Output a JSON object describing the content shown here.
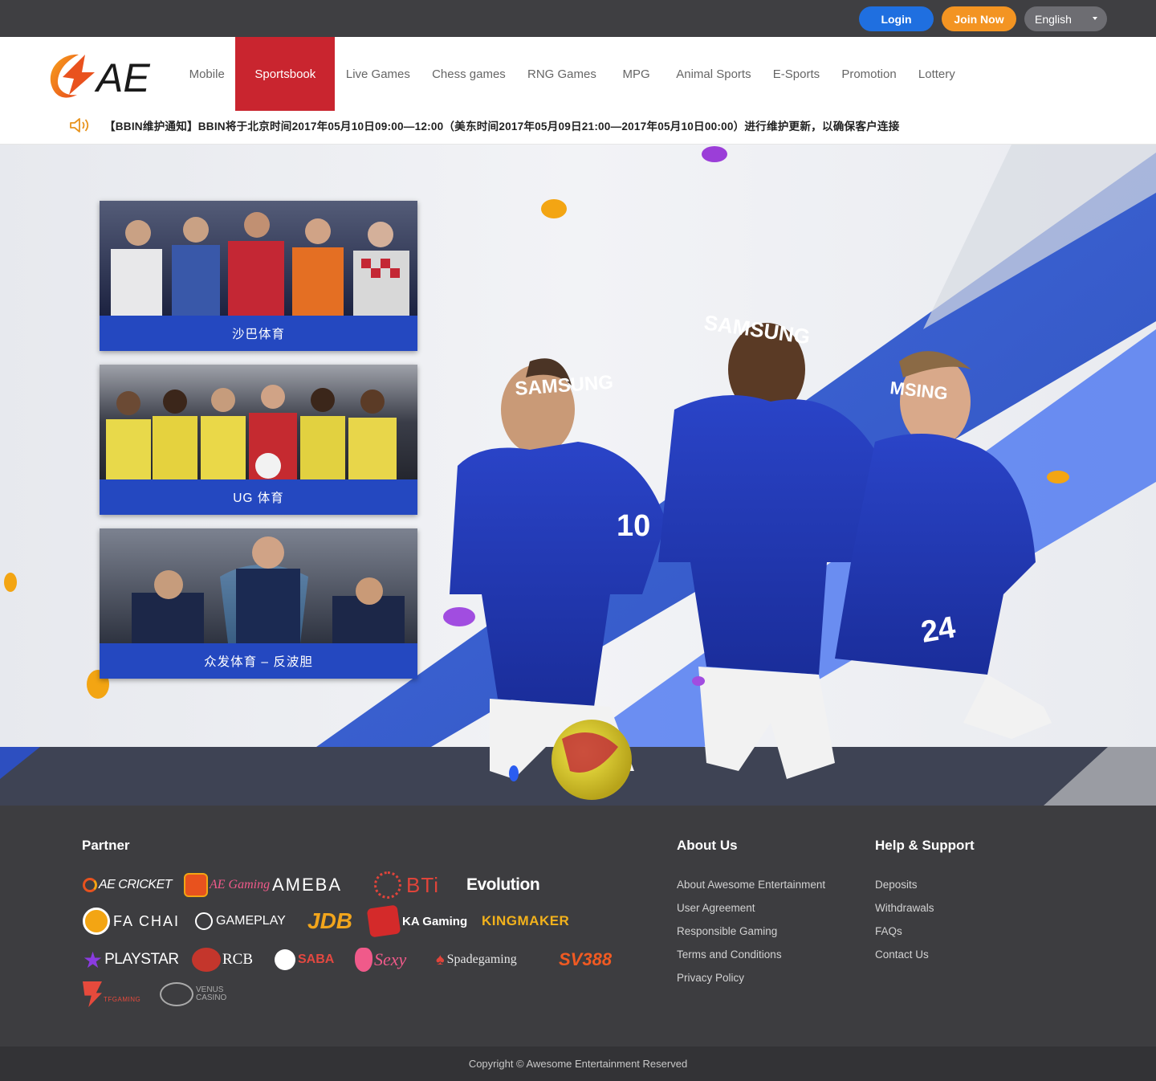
{
  "topbar": {
    "login_label": "Login",
    "join_label": "Join Now",
    "language": "English"
  },
  "header": {
    "logo_text": "AE",
    "nav": [
      "Mobile",
      "Sportsbook",
      "Live Games",
      "Chess games",
      "RNG Games",
      "MPG",
      "Animal Sports",
      "E-Sports",
      "Promotion",
      "Lottery"
    ],
    "active_nav": "Sportsbook",
    "ticker": "【BBIN维护通知】BBIN将于北京时间2017年05月10日09:00—12:00（美东时间2017年05月09日21:00—2017年05月10日00:00）进行维护更新，以确保客户连接"
  },
  "hero": {
    "cards": [
      {
        "label": "沙巴体育"
      },
      {
        "label": "UG 体育"
      },
      {
        "label": "众发体育 – 反波胆"
      }
    ],
    "jersey_text": "SAMSUNG",
    "numbers": [
      "10",
      "24"
    ]
  },
  "footer": {
    "partner_title": "Partner",
    "partners": [
      {
        "name": "AE CRICKET",
        "color": "#ffffff"
      },
      {
        "name": "AE Gaming",
        "color": "#f05a8a"
      },
      {
        "name": "AMEBA",
        "color": "#ffffff"
      },
      {
        "name": "BTi",
        "color": "#e0443a"
      },
      {
        "name": "Evolution",
        "color": "#ffffff"
      },
      {
        "name": "FA CHAI",
        "color": "#ffffff"
      },
      {
        "name": "GAMEPLAY",
        "color": "#ffffff"
      },
      {
        "name": "JDB",
        "color": "#f2a51c"
      },
      {
        "name": "KA Gaming",
        "color": "#ffffff"
      },
      {
        "name": "KINGMAKER",
        "color": "#f2b21c"
      },
      {
        "name": "PLAYSTAR",
        "color": "#ffffff"
      },
      {
        "name": "RCB",
        "color": "#ffffff"
      },
      {
        "name": "SABA",
        "color": "#e34840"
      },
      {
        "name": "Sexy",
        "color": "#f05a8a"
      },
      {
        "name": "Spadegaming",
        "color": "#e6e6e6"
      },
      {
        "name": "SV388",
        "color": "#f05a22"
      },
      {
        "name": "TFGAMING",
        "color": "#e64a3c"
      },
      {
        "name": "VENUS CASINO",
        "color": "#aaaaaa"
      }
    ],
    "about_title": "About Us",
    "about_links": [
      "About Awesome Entertainment",
      "User Agreement",
      "Responsible Gaming",
      "Terms and Conditions",
      "Privacy Policy"
    ],
    "help_title": "Help & Support",
    "help_links": [
      "Deposits",
      "Withdrawals",
      "FAQs",
      "Contact Us"
    ],
    "copyright": "Copyright © Awesome Entertainment Reserved"
  },
  "colors": {
    "login": "#1f6fe0",
    "join": "#f39422",
    "active_nav": "#c9252f",
    "card_bar": "#2448c0",
    "footer_bg": "#3d3d40"
  }
}
